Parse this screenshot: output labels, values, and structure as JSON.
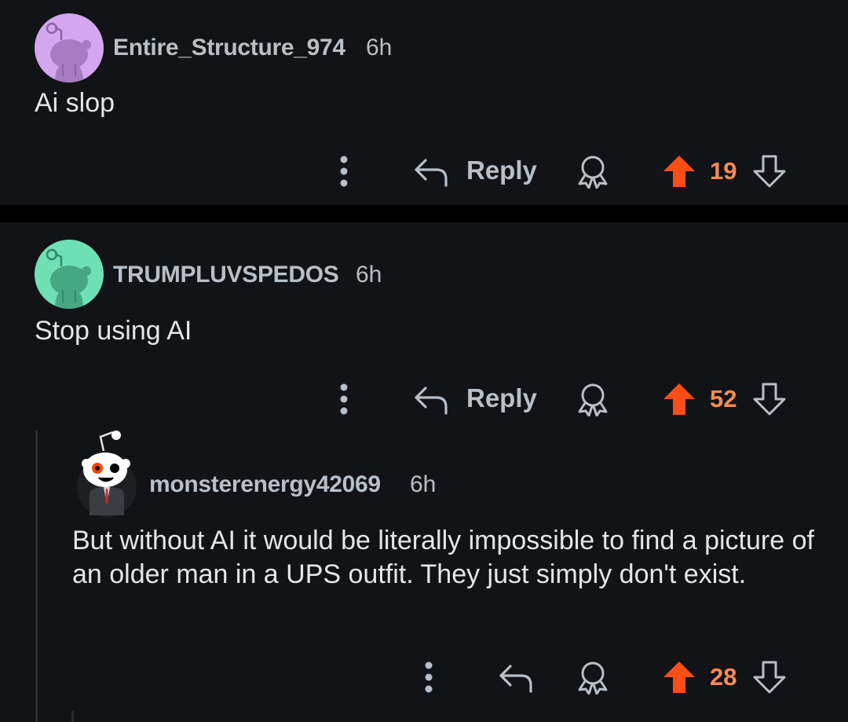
{
  "comments": [
    {
      "username": "Entire_Structure_974",
      "time": "6h",
      "text": "Ai slop",
      "reply_label": "Reply",
      "score": "19",
      "avatar": {
        "icon": "snoo-avatar-icon",
        "bg_color": "#d5a6f0",
        "snoo_color": "#a77bc2"
      }
    },
    {
      "username": "TRUMPLUVSPEDOS",
      "time": "6h",
      "text": "Stop using AI",
      "reply_label": "Reply",
      "score": "52",
      "avatar": {
        "icon": "snoo-avatar-icon",
        "bg_color": "#6fe0b6",
        "snoo_color": "#45a883"
      }
    },
    {
      "username": "monsterenergy42069",
      "time": "6h",
      "text": "But without AI it would be literally impossible to find a picture of an older man in a UPS outfit. They just simply don't exist.",
      "score": "28",
      "avatar": {
        "icon": "snoo-suit-avatar-icon",
        "bg_color": "#1e1f22"
      }
    }
  ],
  "colors": {
    "background": "#121316",
    "separator": "#000000",
    "upvote_active": "#fb4e17",
    "score_text": "#f98a55",
    "meta_text": "#b7c0c9",
    "body_text": "#e3e6ea"
  },
  "icons": [
    "more-options-icon",
    "reply-arrow-icon",
    "award-icon",
    "upvote-arrow-icon",
    "downvote-arrow-icon"
  ]
}
